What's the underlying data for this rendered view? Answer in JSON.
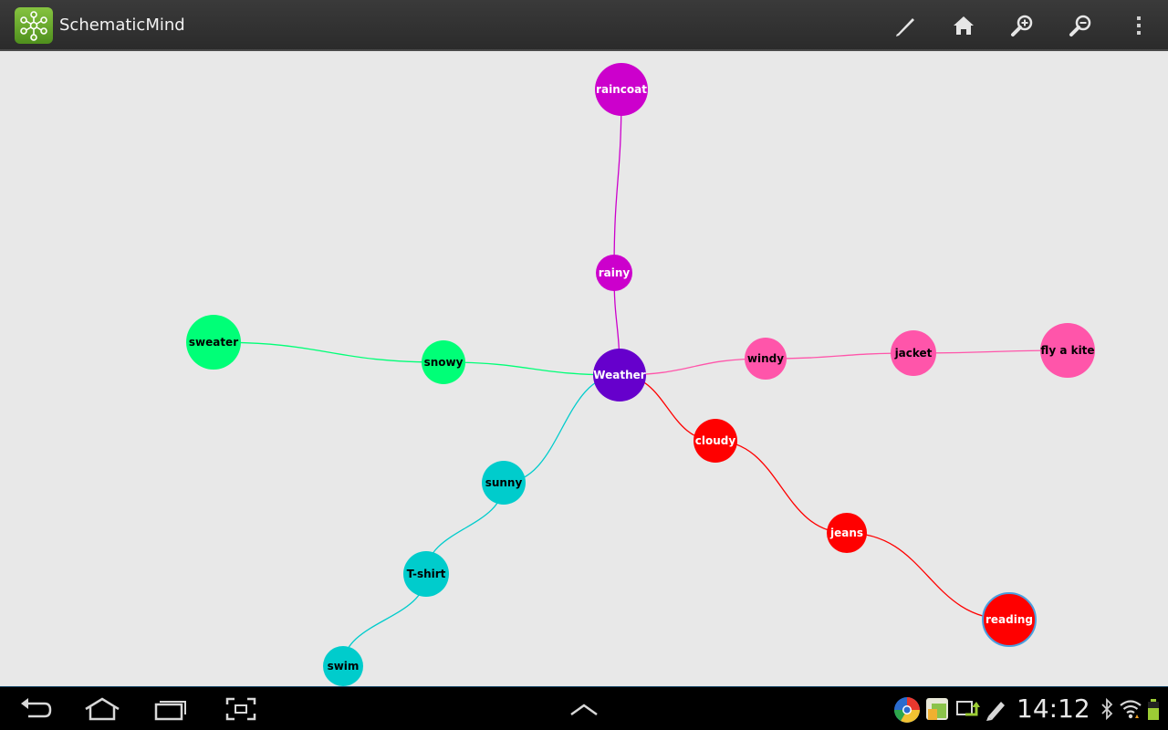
{
  "app": {
    "title": "SchematicMind"
  },
  "toolbar": {
    "actions": [
      {
        "icon": "pen-icon",
        "label": "Edit"
      },
      {
        "icon": "home-icon",
        "label": "Home"
      },
      {
        "icon": "zoom-in-icon",
        "label": "Zoom in"
      },
      {
        "icon": "zoom-out-icon",
        "label": "Zoom out"
      },
      {
        "icon": "overflow-menu-icon",
        "label": "More options"
      }
    ]
  },
  "mindmap": {
    "root": "Weather",
    "nodes": [
      {
        "id": "weather",
        "label": "Weather",
        "color": "#6600cc",
        "text_color": "#ffffff",
        "parent": null
      },
      {
        "id": "rainy",
        "label": "rainy",
        "color": "#cc00cc",
        "text_color": "#ffffff",
        "parent": "weather"
      },
      {
        "id": "raincoat",
        "label": "raincoat",
        "color": "#cc00cc",
        "text_color": "#ffffff",
        "parent": "rainy"
      },
      {
        "id": "snowy",
        "label": "snowy",
        "color": "#00ff77",
        "text_color": "#000000",
        "parent": "weather"
      },
      {
        "id": "sweater",
        "label": "sweater",
        "color": "#00ff77",
        "text_color": "#000000",
        "parent": "snowy"
      },
      {
        "id": "windy",
        "label": "windy",
        "color": "#ff55aa",
        "text_color": "#000000",
        "parent": "weather"
      },
      {
        "id": "jacket",
        "label": "jacket",
        "color": "#ff55aa",
        "text_color": "#000000",
        "parent": "windy"
      },
      {
        "id": "flyakite",
        "label": "fly a kite",
        "color": "#ff55aa",
        "text_color": "#000000",
        "parent": "jacket"
      },
      {
        "id": "cloudy",
        "label": "cloudy",
        "color": "#ff0000",
        "text_color": "#ffffff",
        "parent": "weather"
      },
      {
        "id": "jeans",
        "label": "jeans",
        "color": "#ff0000",
        "text_color": "#ffffff",
        "parent": "cloudy"
      },
      {
        "id": "reading",
        "label": "reading",
        "color": "#ff0000",
        "text_color": "#ffffff",
        "parent": "jeans",
        "selected": true
      },
      {
        "id": "sunny",
        "label": "sunny",
        "color": "#00cccc",
        "text_color": "#000000",
        "parent": "weather"
      },
      {
        "id": "tshirt",
        "label": "T-shirt",
        "color": "#00cccc",
        "text_color": "#000000",
        "parent": "sunny"
      },
      {
        "id": "swim",
        "label": "swim",
        "color": "#00cccc",
        "text_color": "#000000",
        "parent": "tshirt"
      }
    ]
  },
  "navbar": {
    "buttons": [
      {
        "icon": "back-icon",
        "label": "Back"
      },
      {
        "icon": "home-nav-icon",
        "label": "Home"
      },
      {
        "icon": "recent-apps-icon",
        "label": "Recent apps"
      },
      {
        "icon": "screenshot-icon",
        "label": "Screenshot"
      },
      {
        "icon": "chevron-up-icon",
        "label": "Show more"
      }
    ],
    "tray_icons": [
      "chrome-icon",
      "shopping-icon",
      "sync-icon",
      "edit-icon",
      "bluetooth-icon",
      "wifi-icon",
      "battery-icon"
    ],
    "clock": "14:12"
  }
}
